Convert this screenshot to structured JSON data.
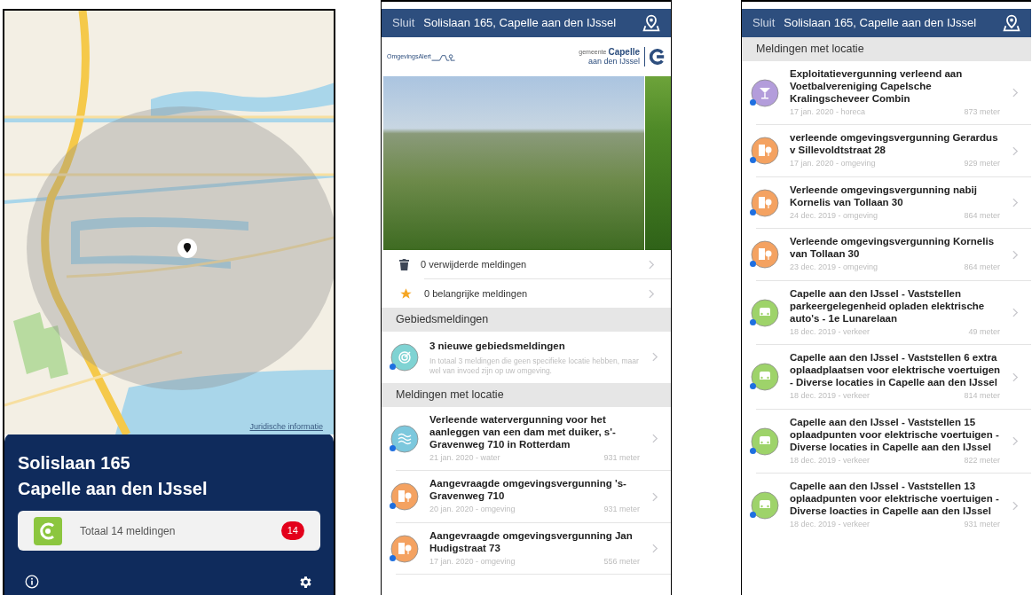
{
  "map_screen": {
    "legal_link": "Juridische informatie",
    "address_line1": "Solislaan 165",
    "address_line2": "Capelle aan den IJssel",
    "total_card": {
      "label": "Totaal 14 meldingen",
      "count": "14"
    }
  },
  "overview_screen": {
    "header": {
      "close": "Sluit",
      "title": "Solislaan 165, Capelle aan den IJssel"
    },
    "brand": "OmgevingsAlert",
    "municipality_prefix": "gemeente",
    "municipality_name": "Capelle",
    "municipality_sub": "aan den IJssel",
    "summary_rows": [
      {
        "kind": "trash",
        "label": "0 verwijderde meldingen"
      },
      {
        "kind": "star",
        "label": "0 belangrijke meldingen"
      }
    ],
    "area_section": "Gebiedsmeldingen",
    "area_item": {
      "title": "3 nieuwe gebiedsmeldingen",
      "description": "In totaal 3 meldingen die geen specifieke locatie hebben, maar wel van invoed zijn op uw omgeving.",
      "unread": true
    },
    "location_section": "Meldingen met locatie",
    "items": [
      {
        "kind": "water",
        "title": "Verleende watervergunning voor het aanleggen van een dam met duiker, s'-Gravenweg 710 in Rotterdam",
        "meta": "21 jan. 2020 - water",
        "distance": "931 meter",
        "unread": true
      },
      {
        "kind": "omgeving",
        "title": "Aangevraagde omgevingsvergunning 's-Gravenweg 710",
        "meta": "20 jan. 2020 - omgeving",
        "distance": "931 meter",
        "unread": true
      },
      {
        "kind": "omgeving",
        "title": "Aangevraagde omgevingsvergunning Jan Hudigstraat 73",
        "meta": "17 jan. 2020 - omgeving",
        "distance": "556 meter",
        "unread": true
      }
    ]
  },
  "list_screen": {
    "header": {
      "close": "Sluit",
      "title": "Solislaan 165, Capelle aan den IJssel"
    },
    "section": "Meldingen met locatie",
    "items": [
      {
        "kind": "horeca",
        "title": "Exploitatievergunning verleend aan Voetbalvereniging Capelsche Kralingscheveer Combin",
        "meta": "17 jan. 2020 - horeca",
        "distance": "873 meter",
        "unread": true
      },
      {
        "kind": "omgeving",
        "title": "verleende omgevingsvergunning Gerardus v Sillevoldtstraat  28",
        "meta": "17 jan. 2020 - omgeving",
        "distance": "929 meter",
        "unread": true
      },
      {
        "kind": "omgeving",
        "title": "Verleende omgevingsvergunning nabij Kornelis van Tollaan  30",
        "meta": "24 dec. 2019 - omgeving",
        "distance": "864 meter",
        "unread": true
      },
      {
        "kind": "omgeving",
        "title": "Verleende omgevingsvergunning Kornelis van Tollaan 30",
        "meta": "23 dec. 2019 - omgeving",
        "distance": "864 meter",
        "unread": true
      },
      {
        "kind": "verkeer",
        "title": "Capelle aan den IJssel - Vaststellen parkeergelegenheid opladen elektrische auto's - 1e Lunarelaan",
        "meta": "18 dec. 2019 - verkeer",
        "distance": "49 meter",
        "unread": true
      },
      {
        "kind": "verkeer",
        "title": "Capelle aan den IJssel - Vaststellen 6 extra oplaadplaatsen voor elektrische voertuigen - Diverse locaties in Capelle aan den IJssel",
        "meta": "18 dec. 2019 - verkeer",
        "distance": "814 meter",
        "unread": true
      },
      {
        "kind": "verkeer",
        "title": "Capelle aan den IJssel - Vaststellen 15 oplaadpunten voor elektrische voertuigen - Diverse locaties in Capelle aan den IJssel",
        "meta": "18 dec. 2019 - verkeer",
        "distance": "822 meter",
        "unread": true
      },
      {
        "kind": "verkeer",
        "title": "Capelle aan den IJssel - Vaststellen 13 oplaadpunten voor elektrische voertuigen - Diverse loacties in Capelle aan den IJssel",
        "meta": "18 dec. 2019 - verkeer",
        "distance": "931 meter",
        "unread": true
      }
    ]
  }
}
